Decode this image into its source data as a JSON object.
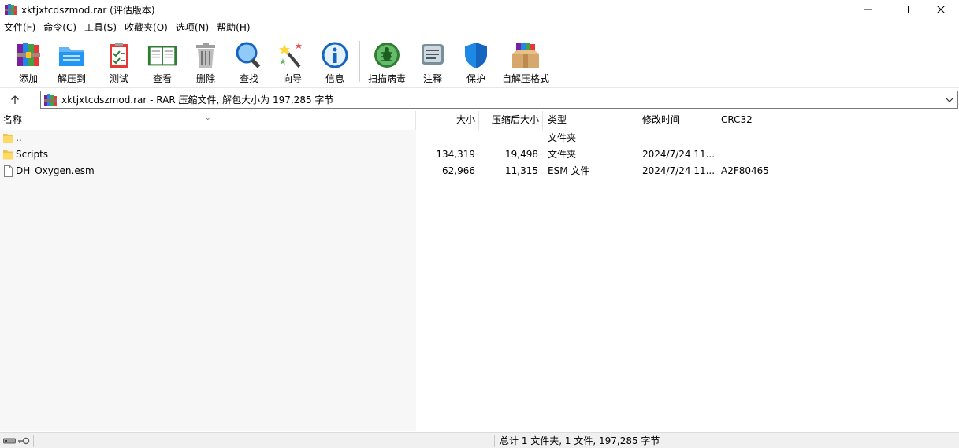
{
  "window": {
    "title": "xktjxtcdszmod.rar (评估版本)",
    "app_icon": "winrar-books-icon",
    "controls": [
      "minimize",
      "maximize",
      "close"
    ]
  },
  "menu": [
    "文件(F)",
    "命令(C)",
    "工具(S)",
    "收藏夹(O)",
    "选项(N)",
    "帮助(H)"
  ],
  "toolbar": {
    "add": "添加",
    "extract_to": "解压到",
    "test": "测试",
    "view": "查看",
    "delete": "删除",
    "find": "查找",
    "wizard": "向导",
    "info": "信息",
    "virus_scan": "扫描病毒",
    "comment": "注释",
    "protect": "保护",
    "sfx": "自解压格式"
  },
  "address": {
    "text": "xktjxtcdszmod.rar - RAR 压缩文件, 解包大小为 197,285 字节"
  },
  "columns": {
    "name": "名称",
    "size": "大小",
    "packed": "压缩后大小",
    "type": "类型",
    "modified": "修改时间",
    "crc": "CRC32"
  },
  "rows": [
    {
      "name": "..",
      "size": "",
      "packed": "",
      "type": "文件夹",
      "modified": "",
      "crc": "",
      "icon": "folder-icon"
    },
    {
      "name": "Scripts",
      "size": "134,319",
      "packed": "19,498",
      "type": "文件夹",
      "modified": "2024/7/24 11...",
      "crc": "",
      "icon": "folder-icon"
    },
    {
      "name": "DH_Oxygen.esm",
      "size": "62,966",
      "packed": "11,315",
      "type": "ESM 文件",
      "modified": "2024/7/24 11...",
      "crc": "A2F80465",
      "icon": "file-icon"
    }
  ],
  "status": {
    "summary": "总计 1 文件夹, 1 文件, 197,285 字节"
  }
}
